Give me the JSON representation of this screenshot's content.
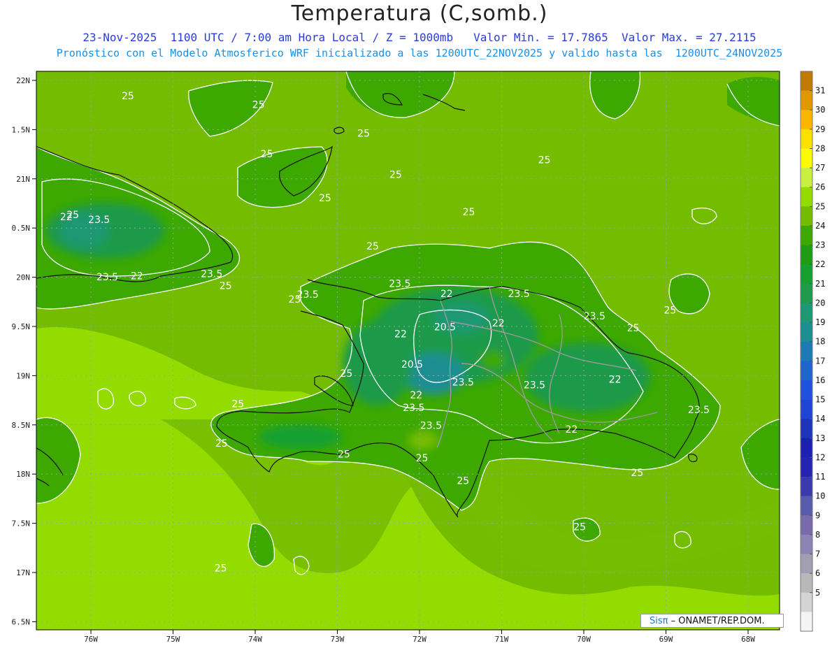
{
  "title": "Temperatura (C,somb.)",
  "subtitle1": "23-Nov-2025  1100 UTC / 7:00 am Hora Local / Z = 1000mb   Valor Min. = 17.7865  Valor Max. = 27.2115",
  "subtitle2": "Pronóstico con el Modelo Atmosferico WRF inicializado a las 1200UTC_22NOV2025 y valido hasta las  1200UTC_24NOV2025",
  "credit": {
    "sis": "Sisπ",
    "org": " – ONAMET/REP.DOM."
  },
  "axes": {
    "lon_ticks": [
      "76W",
      "75W",
      "74W",
      "73W",
      "72W",
      "71W",
      "70W",
      "69W",
      "68W"
    ],
    "lat_ticks": [
      "22N",
      "1.5N",
      "21N",
      "0.5N",
      "20N",
      "9.5N",
      "19N",
      "8.5N",
      "18N",
      "7.5N",
      "17N",
      "6.5N"
    ]
  },
  "colorbar": {
    "levels": [
      "31",
      "30",
      "29",
      "28",
      "27",
      "26",
      "25",
      "24",
      "23",
      "22",
      "21",
      "20",
      "19",
      "18",
      "17",
      "16",
      "15",
      "14",
      "13",
      "12",
      "11",
      "10",
      "9",
      "8",
      "7",
      "6",
      "5"
    ],
    "colors": [
      "#c07a00",
      "#e09800",
      "#fdb600",
      "#fce000",
      "#fcfc00",
      "#c8f040",
      "#94dc00",
      "#74bc00",
      "#3ca800",
      "#1e9c16",
      "#16a030",
      "#1e9a4a",
      "#1c9872",
      "#1c8e92",
      "#1e7ab4",
      "#1e66cc",
      "#1e52dc",
      "#2044d4",
      "#1c34b8",
      "#1c20b0",
      "#2424b0",
      "#3a3aac",
      "#5a5aac",
      "#7a6aac",
      "#8c84b4",
      "#a0a0b0",
      "#b8b8b8",
      "#d4d4d4",
      "#f4f4f4"
    ]
  },
  "contour_labels": [
    {
      "text": "25",
      "lon": -75.55,
      "lat": 21.81
    },
    {
      "text": "25",
      "lon": -73.96,
      "lat": 21.72
    },
    {
      "text": "25",
      "lon": -72.68,
      "lat": 21.43
    },
    {
      "text": "25",
      "lon": -70.48,
      "lat": 21.16
    },
    {
      "text": "25",
      "lon": -72.29,
      "lat": 21.01
    },
    {
      "text": "25",
      "lon": -73.86,
      "lat": 21.22
    },
    {
      "text": "25",
      "lon": -73.15,
      "lat": 20.77
    },
    {
      "text": "25",
      "lon": -76.22,
      "lat": 20.6
    },
    {
      "text": "22",
      "lon": -76.3,
      "lat": 20.58
    },
    {
      "text": "23.5",
      "lon": -75.9,
      "lat": 20.55
    },
    {
      "text": "25",
      "lon": -71.4,
      "lat": 20.63
    },
    {
      "text": "25",
      "lon": -72.57,
      "lat": 20.28
    },
    {
      "text": "23.5",
      "lon": -75.8,
      "lat": 19.97
    },
    {
      "text": "22",
      "lon": -75.44,
      "lat": 19.98
    },
    {
      "text": "23.5",
      "lon": -74.53,
      "lat": 20.0
    },
    {
      "text": "25",
      "lon": -76.72,
      "lat": 19.88
    },
    {
      "text": "25",
      "lon": -74.36,
      "lat": 19.88
    },
    {
      "text": "23.5",
      "lon": -72.24,
      "lat": 19.9
    },
    {
      "text": "23.5",
      "lon": -73.36,
      "lat": 19.79
    },
    {
      "text": "25",
      "lon": -73.52,
      "lat": 19.74
    },
    {
      "text": "22",
      "lon": -71.67,
      "lat": 19.8
    },
    {
      "text": "23.5",
      "lon": -70.79,
      "lat": 19.8
    },
    {
      "text": "23.5",
      "lon": -69.87,
      "lat": 19.57
    },
    {
      "text": "25",
      "lon": -69.4,
      "lat": 19.45
    },
    {
      "text": "25",
      "lon": -68.95,
      "lat": 19.63
    },
    {
      "text": "22",
      "lon": -71.04,
      "lat": 19.5
    },
    {
      "text": "20.5",
      "lon": -71.69,
      "lat": 19.46
    },
    {
      "text": "22",
      "lon": -72.23,
      "lat": 19.39
    },
    {
      "text": "20.5",
      "lon": -72.09,
      "lat": 19.08
    },
    {
      "text": "25",
      "lon": -72.89,
      "lat": 18.99
    },
    {
      "text": "23.5",
      "lon": -71.47,
      "lat": 18.9
    },
    {
      "text": "23.5",
      "lon": -70.6,
      "lat": 18.87
    },
    {
      "text": "22",
      "lon": -69.62,
      "lat": 18.93
    },
    {
      "text": "22",
      "lon": -72.04,
      "lat": 18.77
    },
    {
      "text": "23.5",
      "lon": -72.07,
      "lat": 18.64
    },
    {
      "text": "25",
      "lon": -74.21,
      "lat": 18.68
    },
    {
      "text": "23.5",
      "lon": -68.6,
      "lat": 18.62
    },
    {
      "text": "23.5",
      "lon": -71.86,
      "lat": 18.46
    },
    {
      "text": "22",
      "lon": -70.15,
      "lat": 18.42
    },
    {
      "text": "25",
      "lon": -74.41,
      "lat": 18.28
    },
    {
      "text": "25",
      "lon": -72.92,
      "lat": 18.17
    },
    {
      "text": "25",
      "lon": -71.97,
      "lat": 18.13
    },
    {
      "text": "25",
      "lon": -69.35,
      "lat": 17.98
    },
    {
      "text": "25",
      "lon": -71.47,
      "lat": 17.9
    },
    {
      "text": "25",
      "lon": -70.05,
      "lat": 17.43
    },
    {
      "text": "25",
      "lon": -74.42,
      "lat": 17.01
    }
  ]
}
